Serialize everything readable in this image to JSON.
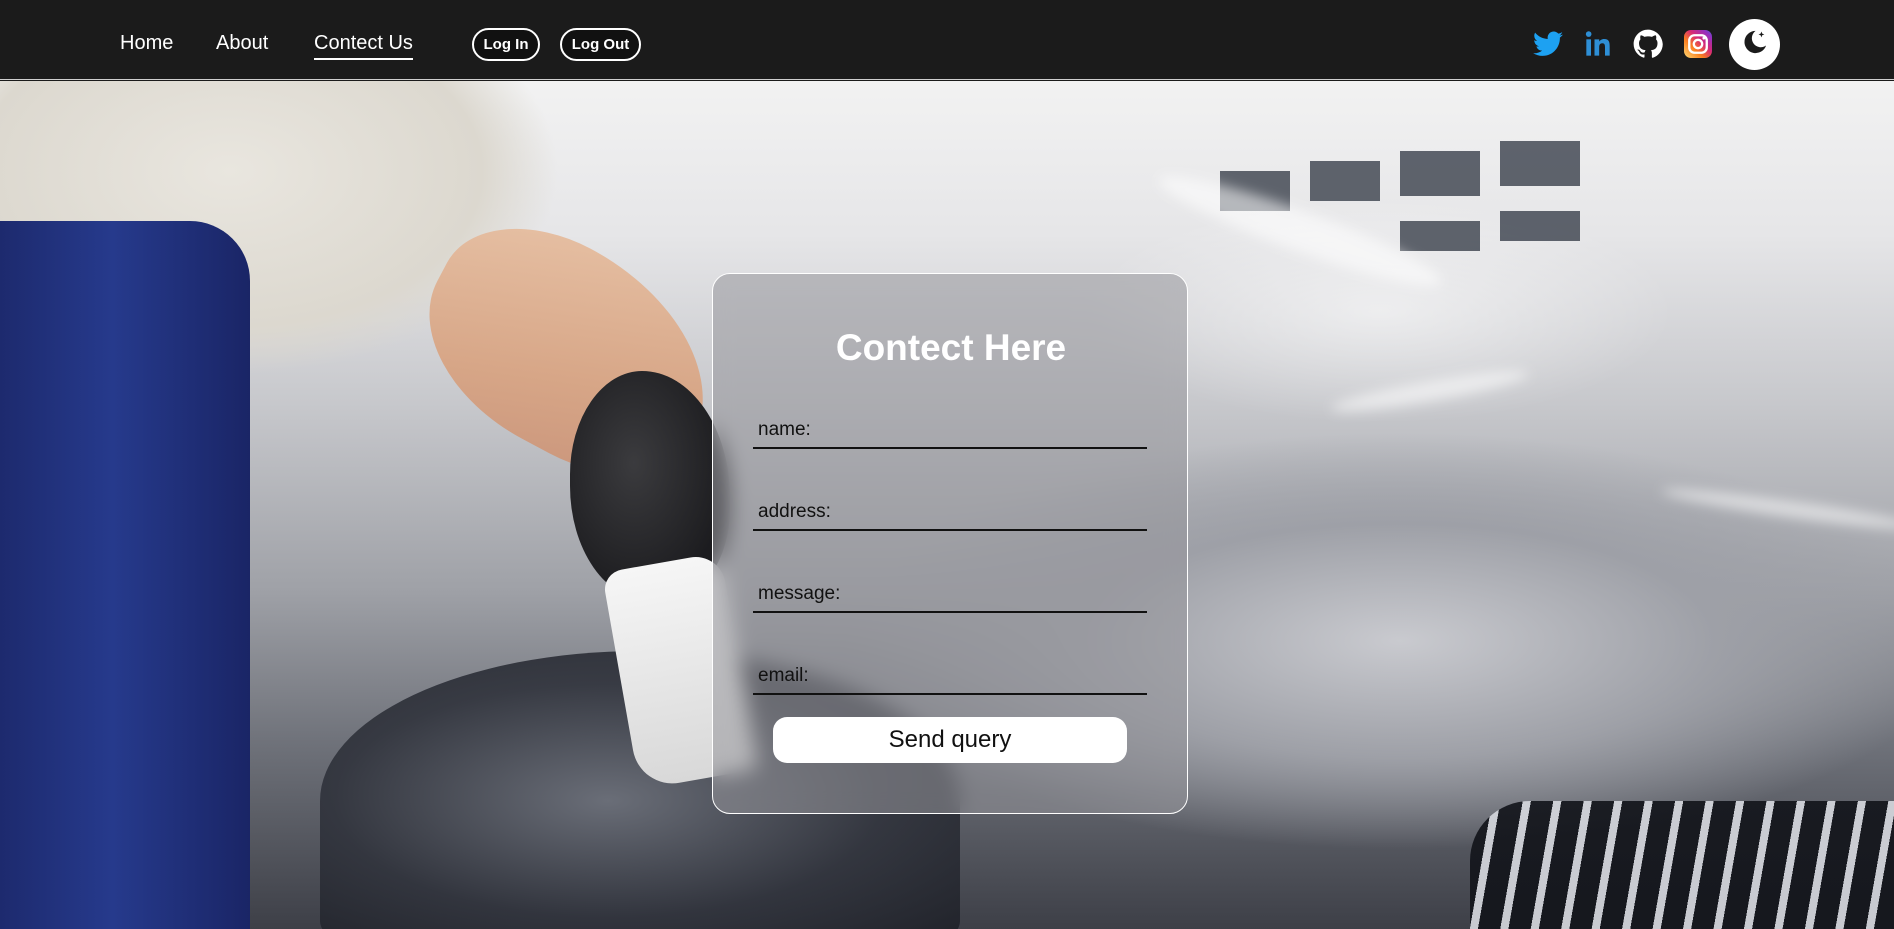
{
  "nav": {
    "links": [
      {
        "label": "Home"
      },
      {
        "label": "About"
      },
      {
        "label": "Contect Us",
        "active": true
      }
    ],
    "buttons": {
      "login": "Log In",
      "logout": "Log Out"
    },
    "social_icons": [
      "twitter-icon",
      "linkedin-icon",
      "github-icon",
      "instagram-icon"
    ],
    "theme_toggle_icon": "moon-star-icon"
  },
  "contact": {
    "title": "Contect Here",
    "fields": {
      "name": "name:",
      "address": "address:",
      "message": "message:",
      "email": "email:"
    },
    "submit_label": "Send query"
  },
  "colors": {
    "navbar_bg": "#1b1b1b",
    "twitter": "#1DA1F2",
    "linkedin": "#2E8FD6"
  }
}
